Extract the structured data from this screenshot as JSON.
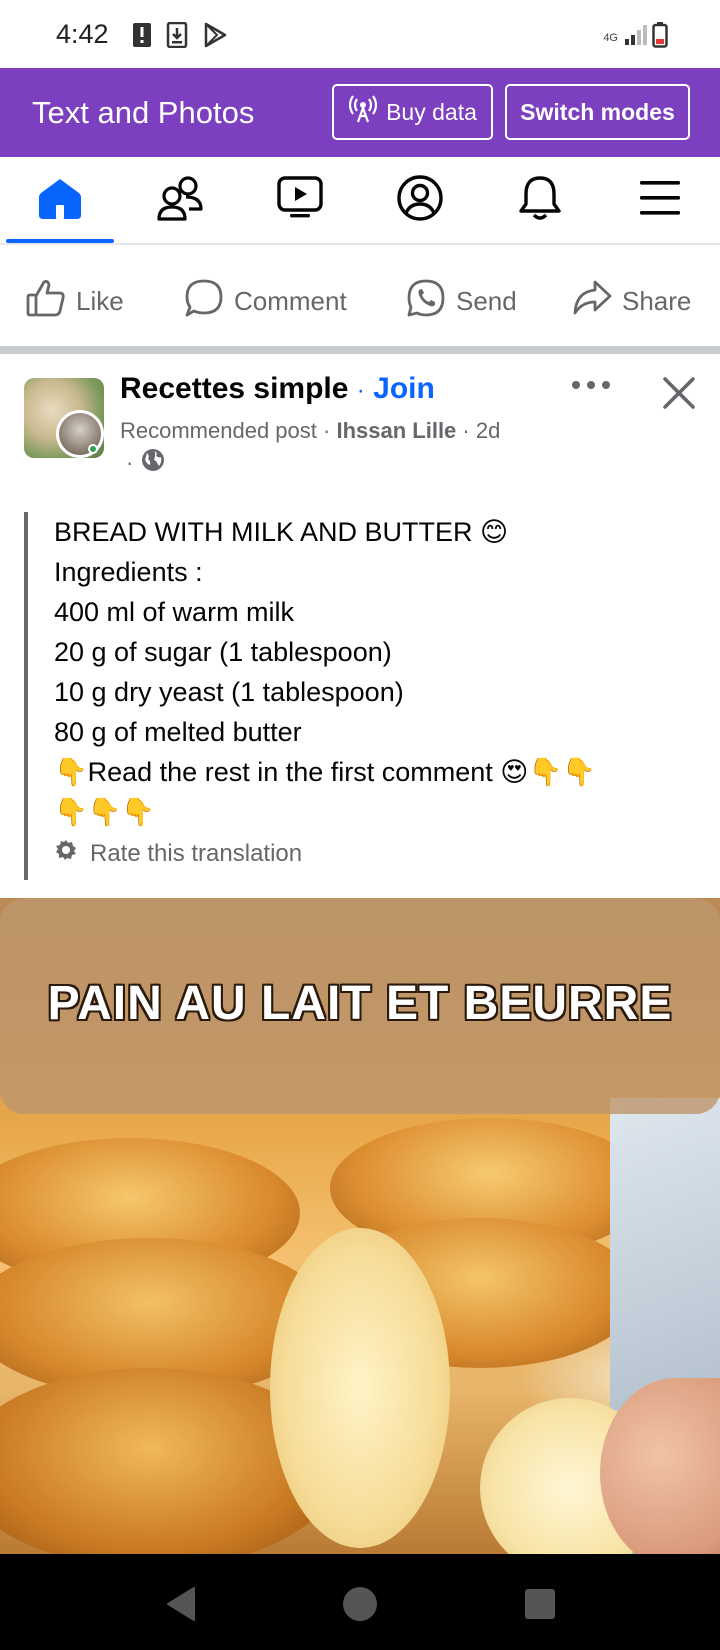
{
  "status_bar": {
    "time": "4:42",
    "network": "4G",
    "icons": [
      "alert-icon",
      "download-icon",
      "play-store-icon",
      "signal-icon",
      "battery-icon"
    ]
  },
  "mode_bar": {
    "title": "Text and Photos",
    "buy_data_label": "Buy data",
    "switch_modes_label": "Switch modes",
    "background_color": "#7b3fbf"
  },
  "nav_bar": {
    "items": [
      {
        "name": "home",
        "icon": "home-icon",
        "active": true
      },
      {
        "name": "friends",
        "icon": "friends-icon",
        "active": false
      },
      {
        "name": "video",
        "icon": "video-icon",
        "active": false
      },
      {
        "name": "profile",
        "icon": "profile-icon",
        "active": false
      },
      {
        "name": "notifications",
        "icon": "bell-icon",
        "active": false
      },
      {
        "name": "menu",
        "icon": "menu-icon",
        "active": false
      }
    ],
    "accent_color": "#0866ff"
  },
  "actions": {
    "like": "Like",
    "comment": "Comment",
    "send": "Send",
    "share": "Share"
  },
  "post": {
    "group_name": "Recettes simple",
    "separator": "·",
    "join_label": "Join",
    "recommended": "Recommended post",
    "author": "Ihssan Lille",
    "age": "2d",
    "privacy_icon": "globe-icon",
    "text_lines": [
      "BREAD WITH MILK AND BUTTER 😊",
      "Ingredients :",
      "400 ml of warm milk",
      "20 g of sugar (1 tablespoon)",
      "10 g dry yeast (1 tablespoon)",
      "80 g of melted butter",
      "👇Read the rest in the first comment 😍👇👇",
      "👇👇👇"
    ],
    "rate_translation": "Rate this translation",
    "image_caption": "PAIN AU LAIT ET BEURRE"
  }
}
